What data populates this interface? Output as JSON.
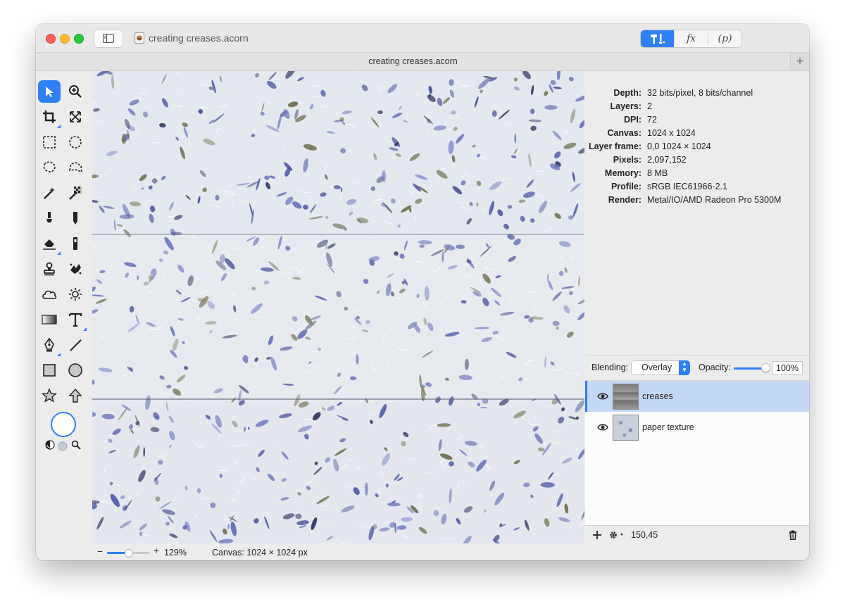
{
  "window": {
    "title": "creating creases.acorn",
    "tab_title": "creating creases.acorn",
    "tab_add_icon": "plus-icon"
  },
  "segments": {
    "tools_icon": "tools-icon",
    "fx_label": "fx",
    "p_label": "(p)"
  },
  "toolbar": {
    "tools": [
      "move-tool-icon",
      "zoom-tool-icon",
      "crop-tool-icon",
      "transform-tool-icon",
      "rect-select-icon",
      "ellipse-select-icon",
      "lasso-icon",
      "polygon-lasso-icon",
      "magic-wand-icon",
      "color-wand-icon",
      "brush-icon",
      "pencil-icon",
      "eraser-icon",
      "clone-icon",
      "stamp-icon",
      "smudge-icon",
      "cloud-icon",
      "sun-icon",
      "gradient-icon",
      "text-icon",
      "pen-icon",
      "line-icon",
      "rectangle-icon",
      "circle-icon",
      "star-icon",
      "arrow-icon"
    ]
  },
  "info": {
    "rows": [
      {
        "label": "Depth:",
        "value": "32 bits/pixel, 8 bits/channel"
      },
      {
        "label": "Layers:",
        "value": "2"
      },
      {
        "label": "DPI:",
        "value": "72"
      },
      {
        "label": "Canvas:",
        "value": "1024 x 1024"
      },
      {
        "label": "Layer frame:",
        "value": "0,0 1024 × 1024"
      },
      {
        "label": "Pixels:",
        "value": "2,097,152"
      },
      {
        "label": "Memory:",
        "value": "8 MB"
      },
      {
        "label": "Profile:",
        "value": "sRGB IEC61966-2.1"
      },
      {
        "label": "Render:",
        "value": "Metal/IO/AMD Radeon Pro 5300M"
      }
    ]
  },
  "layers_panel": {
    "blending_label": "Blending:",
    "blending_value": "Overlay",
    "opacity_label": "Opacity:",
    "opacity_value": "100%",
    "opacity_fraction": 1.0,
    "layers": [
      {
        "name": "creases",
        "selected": true
      },
      {
        "name": "paper texture",
        "selected": false
      }
    ],
    "coords": "150,45"
  },
  "status": {
    "zoom_minus": "−",
    "zoom_plus": "+",
    "zoom_value": "129%",
    "zoom_fraction": 0.5,
    "canvas_size": "Canvas: 1024 × 1024 px"
  },
  "colors": {
    "accent": "#2f7ff7",
    "selected_row": "#c4d8f8",
    "petal_blue": "#4a56a8",
    "petal_dark": "#2b2f5e",
    "petal_olive": "#6b6a4a",
    "paper": "#e3e7ee"
  }
}
